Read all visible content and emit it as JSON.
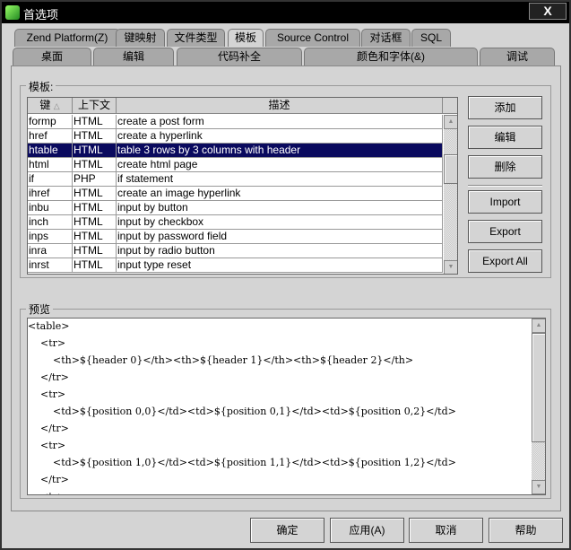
{
  "window": {
    "title": "首选项",
    "close_label": "X"
  },
  "tabs_row1": [
    "Zend Platform(Z)",
    "键映射",
    "文件类型",
    "模板",
    "Source Control",
    "对话框",
    "SQL"
  ],
  "tabs_row2": [
    "桌面",
    "编辑",
    "代码补全",
    "颜色和字体(&)",
    "调试"
  ],
  "selected_tab": "模板",
  "templates": {
    "group_label": "模板:",
    "columns": [
      "键",
      "上下文",
      "描述"
    ],
    "sort_indicator": "△",
    "rows": [
      {
        "key": "formp",
        "context": "HTML",
        "desc": "create a post form"
      },
      {
        "key": "href",
        "context": "HTML",
        "desc": "create a hyperlink"
      },
      {
        "key": "htable",
        "context": "HTML",
        "desc": "table 3 rows by 3 columns with header",
        "selected": true
      },
      {
        "key": "html",
        "context": "HTML",
        "desc": "create html page"
      },
      {
        "key": "if",
        "context": "PHP",
        "desc": "if statement"
      },
      {
        "key": "ihref",
        "context": "HTML",
        "desc": "create an image hyperlink"
      },
      {
        "key": "inbu",
        "context": "HTML",
        "desc": "input by button"
      },
      {
        "key": "inch",
        "context": "HTML",
        "desc": "input by checkbox"
      },
      {
        "key": "inps",
        "context": "HTML",
        "desc": "input by password field"
      },
      {
        "key": "inra",
        "context": "HTML",
        "desc": "input by radio button"
      },
      {
        "key": "inrst",
        "context": "HTML",
        "desc": "input type reset"
      }
    ],
    "buttons": {
      "add": "添加",
      "edit": "编辑",
      "delete": "删除",
      "import": "Import",
      "export": "Export",
      "export_all": "Export All"
    }
  },
  "preview": {
    "group_label": "预览",
    "lines": [
      "<table>",
      "    <tr>",
      "        <th>${header 0}</th><th>${header 1}</th><th>${header 2}</th>",
      "    </tr>",
      "    <tr>",
      "        <td>${position 0,0}</td><td>${position 0,1}</td><td>${position 0,2}</td>",
      "    </tr>",
      "    <tr>",
      "        <td>${position 1,0}</td><td>${position 1,1}</td><td>${position 1,2}</td>",
      "    </tr>",
      "    <tr>"
    ]
  },
  "footer": {
    "ok": "确定",
    "apply": "应用(A)",
    "cancel": "取消",
    "help": "帮助"
  }
}
